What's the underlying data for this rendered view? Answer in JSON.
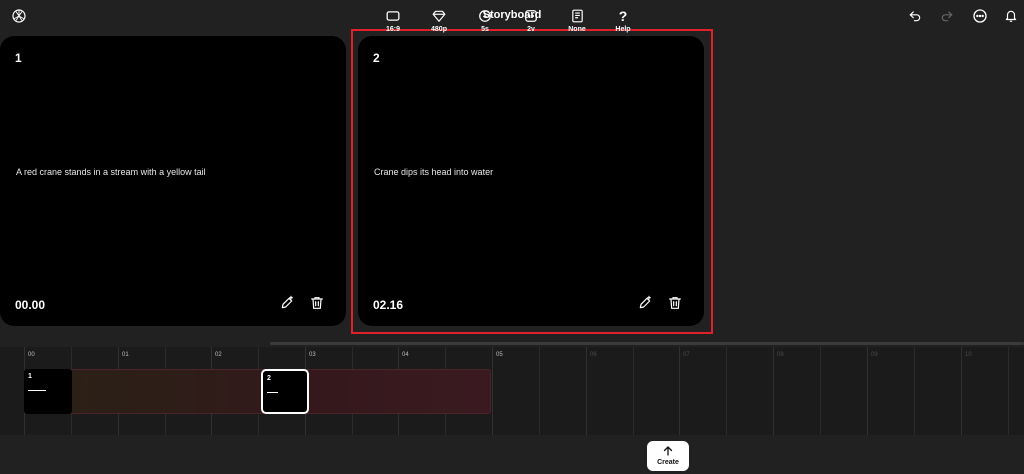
{
  "header": {
    "title": "Storyboard"
  },
  "cards": [
    {
      "number": "1",
      "description": "A red crane stands in a stream with a yellow tail",
      "time": "00.00"
    },
    {
      "number": "2",
      "description": "Crane dips its head into water",
      "time": "02.16"
    }
  ],
  "timeline": {
    "ticks": [
      "00",
      "01",
      "02",
      "03",
      "04",
      "05",
      "06",
      "07",
      "08",
      "09",
      "10"
    ],
    "clips": [
      {
        "label": "1"
      },
      {
        "label": "2"
      }
    ]
  },
  "toolbar": [
    {
      "label": "16:9",
      "icon": "aspect-ratio-icon"
    },
    {
      "label": "480p",
      "icon": "diamond-icon"
    },
    {
      "label": "5s",
      "icon": "clock-icon"
    },
    {
      "label": "2v",
      "icon": "variations-icon"
    },
    {
      "label": "None",
      "icon": "book-icon"
    },
    {
      "label": "Help",
      "icon": "question-icon"
    }
  ],
  "create_label": "Create",
  "colors": {
    "selection": "#e0202a",
    "background": "#212121",
    "card": "#000000"
  }
}
